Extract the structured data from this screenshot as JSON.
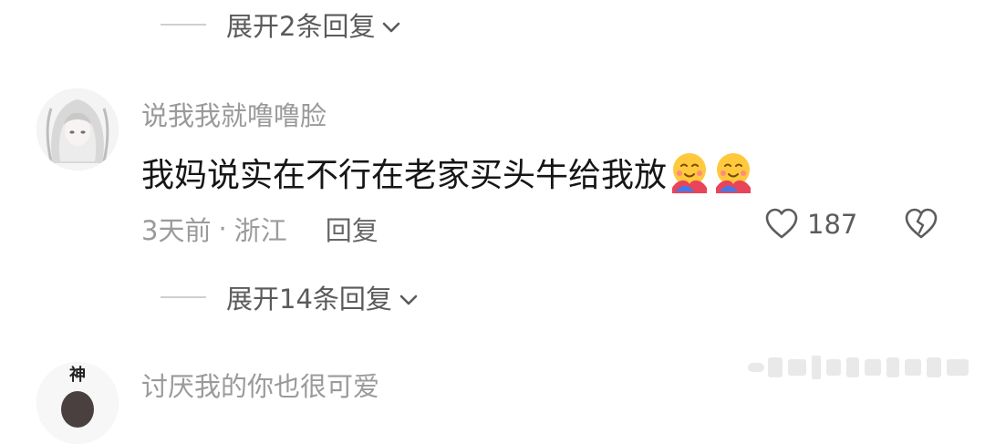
{
  "top_expand": {
    "label": "展开2条回复"
  },
  "comment": {
    "username": "说我我就噜噜脸",
    "text": "我妈说实在不行在老家买头牛给我放",
    "emojis": [
      "hug-emoji",
      "hug-emoji"
    ],
    "time": "3天前",
    "separator": "·",
    "location": "浙江",
    "reply_label": "回复",
    "like_count": "187"
  },
  "mid_expand": {
    "label": "展开14条回复"
  },
  "next_comment": {
    "username": "讨厌我的你也很可爱",
    "avatar_text": "神"
  }
}
